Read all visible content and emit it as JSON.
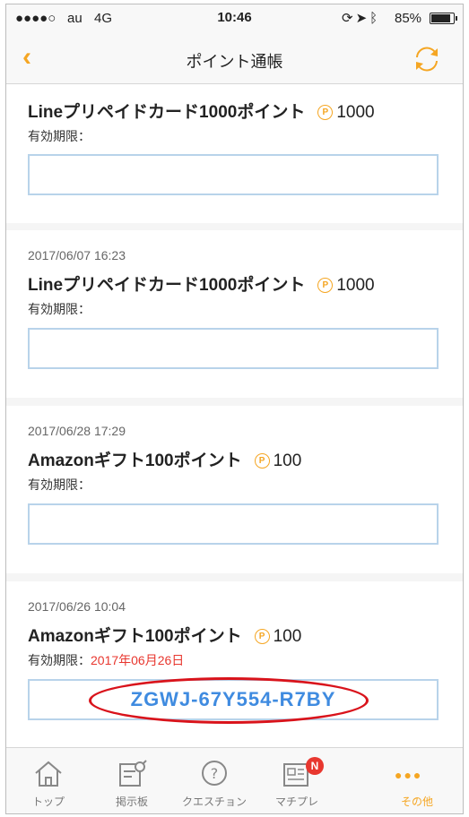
{
  "status": {
    "carrier": "au",
    "network": "4G",
    "time": "10:46",
    "battery": "85%"
  },
  "nav": {
    "title": "ポイント通帳"
  },
  "items": [
    {
      "date": "",
      "name": "Lineプリペイドカード1000ポイント",
      "points": "1000",
      "expiry_label": "有効期限：",
      "expiry_date": "",
      "code": ""
    },
    {
      "date": "2017/06/07 16:23",
      "name": "Lineプリペイドカード1000ポイント",
      "points": "1000",
      "expiry_label": "有効期限：",
      "expiry_date": "",
      "code": ""
    },
    {
      "date": "2017/06/28 17:29",
      "name": "Amazonギフト100ポイント",
      "points": "100",
      "expiry_label": "有効期限：",
      "expiry_date": "",
      "code": ""
    },
    {
      "date": "2017/06/26 10:04",
      "name": "Amazonギフト100ポイント",
      "points": "100",
      "expiry_label": "有効期限：",
      "expiry_date": "2017年06月26日",
      "code": "ZGWJ-67Y554-R7BY"
    }
  ],
  "point_badge": "P",
  "tabs": [
    {
      "label": "トップ",
      "icon": "home-icon"
    },
    {
      "label": "掲示板",
      "icon": "board-icon"
    },
    {
      "label": "クエスチョン",
      "icon": "question-icon"
    },
    {
      "label": "マチプレ",
      "icon": "news-icon",
      "badge": "N"
    },
    {
      "label": "その他",
      "icon": "more-icon",
      "active": true
    }
  ],
  "colors": {
    "accent": "#f5a623",
    "code_text": "#3f8be0",
    "expiry_red": "#e8372f",
    "annotation_red": "#d9131b"
  }
}
